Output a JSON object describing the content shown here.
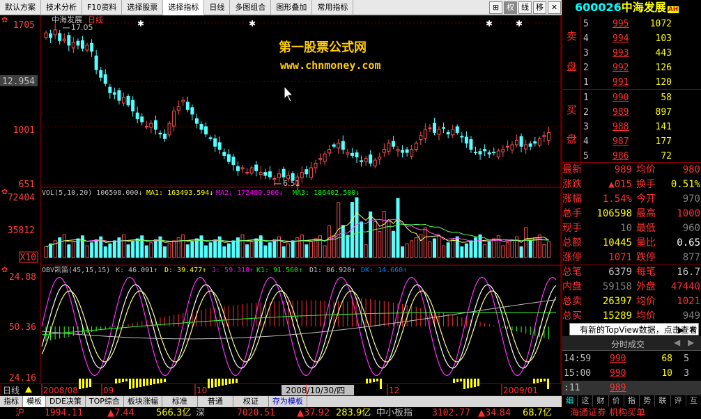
{
  "menu": {
    "items": [
      "默认方案",
      "技术分析",
      "F10资料",
      "选择股票",
      "选择指标",
      "日线",
      "多图组合",
      "图形叠加",
      "常用指标"
    ],
    "selected_index": 4,
    "icons": [
      "⊞",
      "权",
      "线",
      "移",
      "✕"
    ]
  },
  "stock": {
    "code": "600026",
    "name": "中海发展",
    "tag": "AH"
  },
  "main_chart": {
    "title": "中海发展",
    "period": "日线",
    "y_labels": [
      "1705",
      "12.954",
      "1001",
      "651"
    ],
    "high_mark": "17.05",
    "low_mark": "6.51",
    "watermark_1": "第一股票公式网",
    "watermark_2": "www.chnmoney.com"
  },
  "vol_chart": {
    "y_labels": [
      "72404",
      "35812",
      "X10"
    ],
    "legend": [
      {
        "text": "VOL(5,10,20) 106598.000↓",
        "color": "#c0c0c0"
      },
      {
        "text": "MA1: 163493.594↓",
        "color": "#ffff00"
      },
      {
        "text": "MA2: 172480.906↓",
        "color": "#ff00ff"
      },
      {
        "text": "MA3: 186402.500↓",
        "color": "#00ff00"
      }
    ]
  },
  "obv_chart": {
    "y_labels": [
      "24.88",
      "50.36",
      "24.16"
    ],
    "legend": [
      {
        "text": "OBV凯笛(45,15,15)",
        "color": "#c0c0c0"
      },
      {
        "text": "K: 46.091↑",
        "color": "#c0c0c0"
      },
      {
        "text": "D: 39.477↑",
        "color": "#ffff00"
      },
      {
        "text": "J: 59.318↑",
        "color": "#ff00ff"
      },
      {
        "text": "K1: 91.560↑",
        "color": "#00ff00"
      },
      {
        "text": "D1: 86.920↑",
        "color": "#c0c0c0"
      },
      {
        "text": "DK: 14.660↑",
        "color": "#0080ff"
      }
    ]
  },
  "time_axis": {
    "label": "日线",
    "ticks": [
      "2008/08",
      "09",
      "10",
      "2008/10/30/四",
      "12",
      "2009/01"
    ]
  },
  "order_book": {
    "sell_label": [
      "卖",
      "盘"
    ],
    "buy_label": [
      "买",
      "盘"
    ],
    "sells": [
      {
        "n": "5",
        "price": "995",
        "vol": "1072"
      },
      {
        "n": "4",
        "price": "994",
        "vol": "103"
      },
      {
        "n": "3",
        "price": "993",
        "vol": "443"
      },
      {
        "n": "2",
        "price": "992",
        "vol": "126"
      },
      {
        "n": "1",
        "price": "991",
        "vol": "120"
      }
    ],
    "buys": [
      {
        "n": "1",
        "price": "990",
        "vol": "58"
      },
      {
        "n": "2",
        "price": "989",
        "vol": "897"
      },
      {
        "n": "3",
        "price": "988",
        "vol": "141"
      },
      {
        "n": "4",
        "price": "987",
        "vol": "177"
      },
      {
        "n": "5",
        "price": "986",
        "vol": "72"
      }
    ]
  },
  "quotes": [
    {
      "l": "最新",
      "v": "989",
      "vc": "#ff3030",
      "l2": "均价",
      "v2": "980",
      "v2c": "#ff3030"
    },
    {
      "l": "涨跌",
      "v": "▲015",
      "vc": "#ff3030",
      "l2": "换手",
      "v2": "0.51%",
      "v2c": "#ffff00"
    },
    {
      "l": "涨幅",
      "v": "1.54%",
      "vc": "#ff3030",
      "l2": "今开",
      "v2": "970",
      "v2c": "#808080"
    },
    {
      "l": "总手",
      "v": "106598",
      "vc": "#ffff00",
      "l2": "最高",
      "v2": "1000",
      "v2c": "#ff3030"
    },
    {
      "l": "现手",
      "v": "10",
      "vc": "#808080",
      "l2": "最低",
      "v2": "960",
      "v2c": "#808080"
    },
    {
      "l": "总额",
      "v": "10445",
      "vc": "#ffff00",
      "l2": "量比",
      "v2": "0.65",
      "v2c": "#ffffff"
    },
    {
      "l": "涨停",
      "v": "1071",
      "vc": "#ff3030",
      "l2": "跌停",
      "v2": "877",
      "v2c": "#808080"
    },
    {
      "l": "总笔",
      "v": "6379",
      "vc": "#c0c0c0",
      "l2": "每笔",
      "v2": "16.7",
      "v2c": "#c0c0c0"
    },
    {
      "l": "内盘",
      "v": "59158",
      "vc": "#808080",
      "l2": "外盘",
      "v2": "47440",
      "v2c": "#ff3030"
    },
    {
      "l": "总卖",
      "v": "26397",
      "vc": "#ffff00",
      "l2": "均价",
      "v2": "1021",
      "v2c": "#ff3030"
    },
    {
      "l": "总买",
      "v": "15289",
      "vc": "#ffff00",
      "l2": "均价",
      "v2": "949",
      "v2c": "#808080"
    }
  ],
  "topview": "有新的TopView数据，点击查看",
  "fenshi": "分时成交",
  "trades": [
    {
      "t": "14:59",
      "p": "990",
      "v": "68",
      "s": "5"
    },
    {
      "t": "15:00",
      "p": "990",
      "v": "10",
      "s": "3"
    },
    {
      "t": ":11",
      "p": "989",
      "v": "",
      "s": ""
    }
  ],
  "right_tabs": [
    "细",
    "这",
    "财",
    "价",
    "指",
    "势",
    "联",
    "评",
    "互"
  ],
  "bottom_tabs": [
    "指标",
    "模板",
    "DDE决策",
    "TOP综合",
    "板块涨幅",
    "标准",
    "普通",
    "权证",
    "存为模板"
  ],
  "status": {
    "sh_label": "沪",
    "sh_index": "1994.11",
    "sh_chg": "▲7.44",
    "sh_amt": "566.3亿",
    "sz_label": "深",
    "sz_index": "7020.51",
    "sz_chg": "▲37.92",
    "sz_amt": "283.9亿",
    "zx_label": "中小板指",
    "zx_index": "3102.77",
    "zx_chg": "▲34.84",
    "zx_amt": "68.7亿",
    "marquee": "海通证券 机构买单"
  },
  "chart_data": {
    "type": "candlestick",
    "note_series": "closes approximated from chart, ×0.01 yuan",
    "y_range": [
      651,
      1705
    ]
  }
}
